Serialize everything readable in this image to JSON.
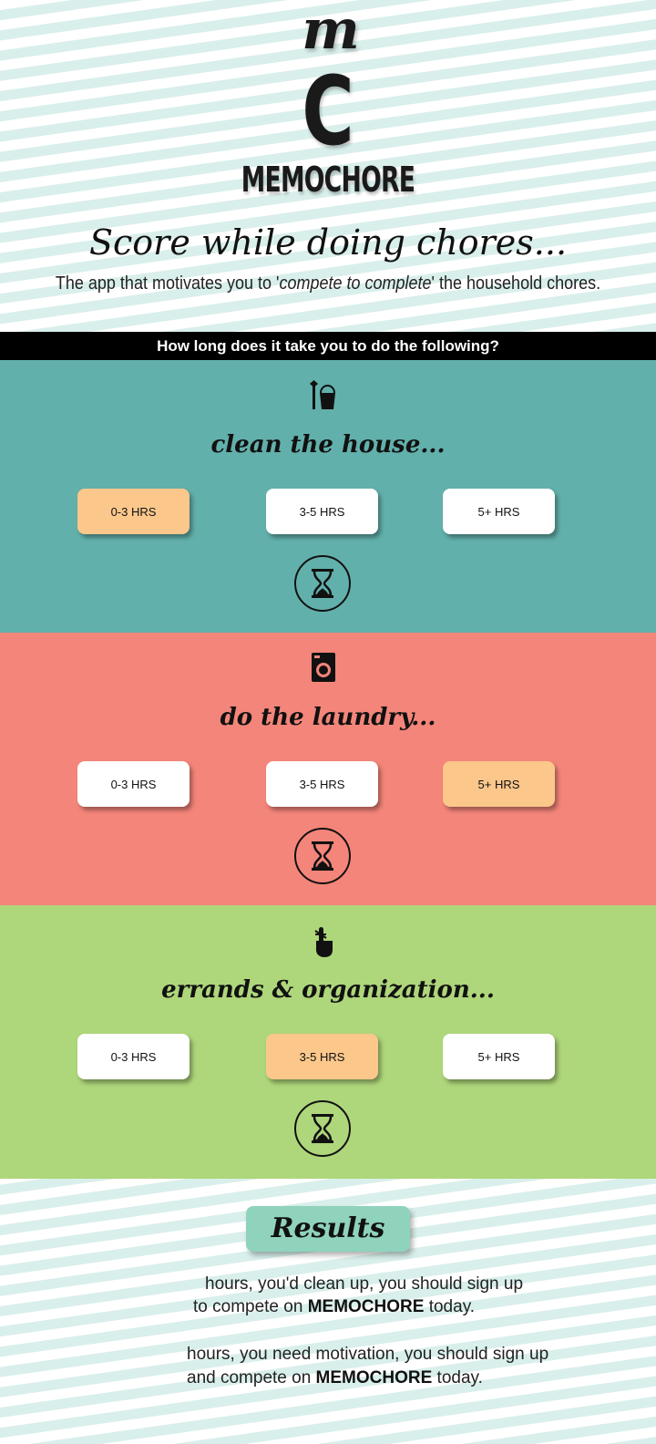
{
  "logo": {
    "mark": "m",
    "letter": "C",
    "name": "MEMOCHORE"
  },
  "tagline": "Score while doing chores...",
  "subtitle": {
    "pre": "The app that motivates you to '",
    "em": "compete to complete",
    "post": "' the household chores."
  },
  "question": "How long does it take you to do the following?",
  "colors": {
    "teal": "#62b0ab",
    "salmon": "#f4857a",
    "green": "#aed67a",
    "selected": "#fbc78b",
    "results": "#8fd3bd"
  },
  "sections": [
    {
      "title": "clean the house...",
      "icon": "cleaning-bucket-icon",
      "options": [
        "0-3 HRS",
        "3-5 HRS",
        "5+ HRS"
      ],
      "selected": 0
    },
    {
      "title": "do the laundry...",
      "icon": "washing-machine-icon",
      "options": [
        "0-3 HRS",
        "3-5 HRS",
        "5+ HRS"
      ],
      "selected": 2
    },
    {
      "title": "errands & organization...",
      "icon": "finger-reminder-icon",
      "options": [
        "0-3 HRS",
        "3-5 HRS",
        "5+ HRS"
      ],
      "selected": 1
    }
  ],
  "results": {
    "label": "Results",
    "line1a": "hours, you'd clean up, you should sign up",
    "line1b_pre": "to compete on ",
    "line1b_brand": "MEMOCHORE",
    "line1b_post": " today.",
    "line2a": "hours, you need motivation, you should sign up",
    "line2b_pre": "and compete on ",
    "line2b_brand": "MEMOCHORE",
    "line2b_post": " today."
  }
}
